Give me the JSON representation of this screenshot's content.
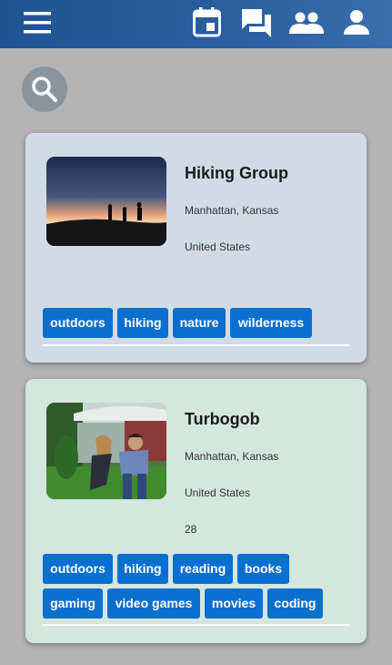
{
  "topbar": {
    "icons": [
      "menu-icon",
      "calendar-icon",
      "chat-icon",
      "groups-icon",
      "account-icon"
    ],
    "color": "#2a5f9f"
  },
  "search": {
    "icon": "search-icon"
  },
  "groups": [
    {
      "name": "Hiking Group",
      "city": "Manhattan, Kansas",
      "country": "United States",
      "tags": [
        "outdoors",
        "hiking",
        "nature",
        "wilderness"
      ]
    },
    {
      "name": "Turbogob",
      "city": "Manhattan, Kansas",
      "country": "United States",
      "extra": "28",
      "tags": [
        "outdoors",
        "hiking",
        "reading",
        "books",
        "gaming",
        "video games",
        "movies",
        "coding"
      ]
    }
  ],
  "colors": {
    "tag": "#0b6fd0",
    "card1": "#d1dbe6",
    "card2": "#d4e6de"
  }
}
